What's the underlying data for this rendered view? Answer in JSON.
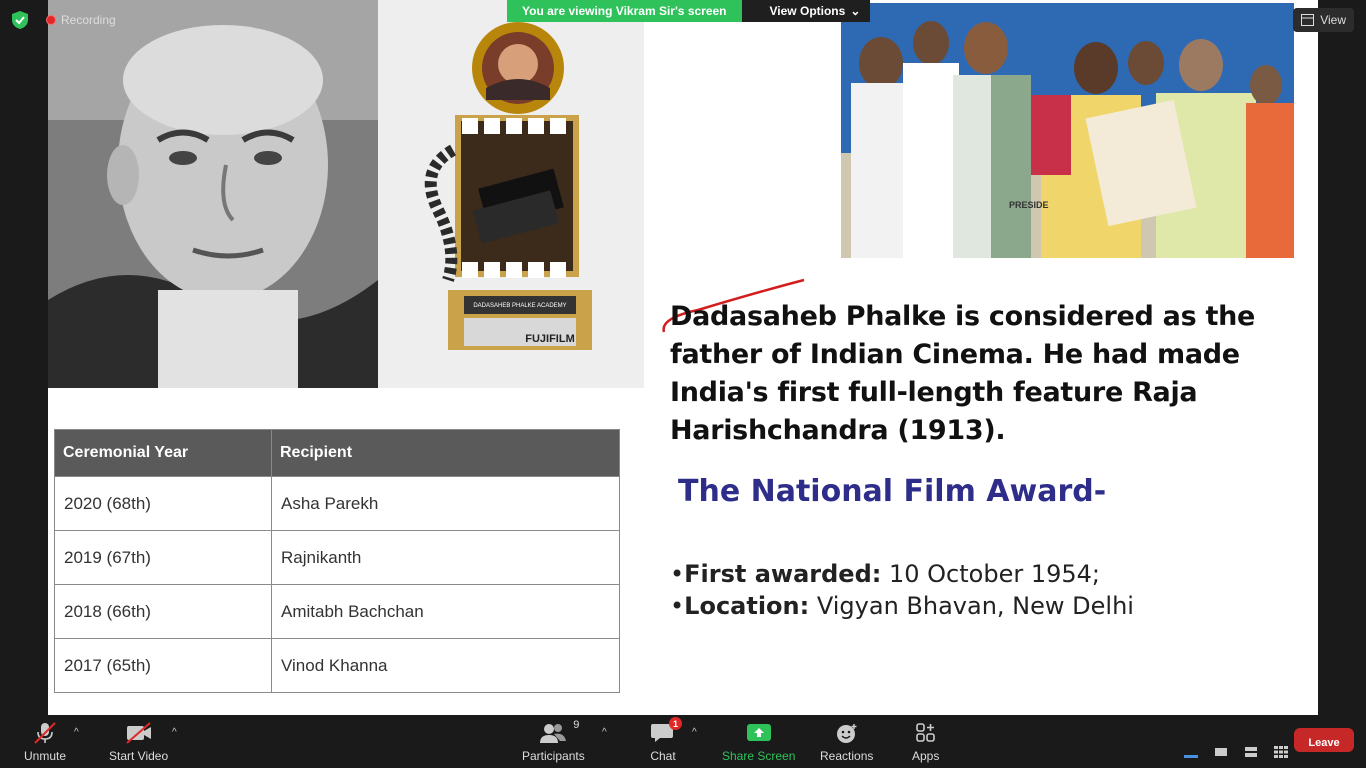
{
  "recording": {
    "label": "Recording"
  },
  "viewing": {
    "text": "You are viewing Vikram Sir's screen",
    "options_label": "View Options"
  },
  "view_button": {
    "label": "View"
  },
  "slide": {
    "intro_text": "Dadasaheb Phalke is considered as the father of Indian Cinema. He had made India's first full-length feature Raja Harishchandra (1913).",
    "award_title": "The National Film Award-",
    "facts": [
      {
        "label": "First awarded:",
        "value": "10 October 1954;"
      },
      {
        "label": "Location:",
        "value": "Vigyan Bhavan, New Delhi"
      }
    ],
    "table": {
      "headers": [
        "Ceremonial Year",
        "Recipient"
      ],
      "rows": [
        [
          "2020 (68th)",
          "Asha Parekh"
        ],
        [
          "2019 (67th)",
          "Rajnikanth"
        ],
        [
          "2018 (66th)",
          "Amitabh Bachchan"
        ],
        [
          "2017 (65th)",
          "Vinod Khanna"
        ]
      ]
    },
    "trophy_text": {
      "plaque": "DADASAHEB PHALKE ACADEMY",
      "brand": "FUJIFILM"
    },
    "ceremony_sign": "PRESIDE"
  },
  "toolbar": {
    "unmute": "Unmute",
    "start_video": "Start Video",
    "participants": "Participants",
    "participants_count": "9",
    "chat": "Chat",
    "chat_badge": "1",
    "share_screen": "Share Screen",
    "reactions": "Reactions",
    "apps": "Apps",
    "leave": "Leave"
  },
  "colors": {
    "share_green": "#2fc25b",
    "award_title": "#2e2e8a",
    "leave_red": "#c62828"
  }
}
